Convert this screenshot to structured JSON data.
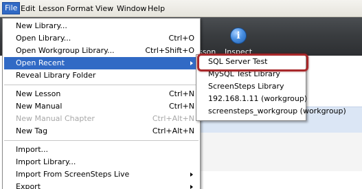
{
  "menubar": {
    "items": [
      "File",
      "Edit",
      "Lesson",
      "Format",
      "View",
      "Window",
      "Help"
    ]
  },
  "toolbar": {
    "partial_label": "sson",
    "inspect_label": "Inspect",
    "inspect_icon": "i"
  },
  "file_menu": {
    "items": [
      {
        "label": "New Library...",
        "shortcut": ""
      },
      {
        "label": "Open Library...",
        "shortcut": "Ctrl+O"
      },
      {
        "label": "Open Workgroup Library...",
        "shortcut": "Ctrl+Shift+O"
      },
      {
        "label": "Open Recent",
        "shortcut": ""
      },
      {
        "label": "Reveal Library Folder",
        "shortcut": ""
      },
      {
        "label": "New Lesson",
        "shortcut": "Ctrl+N"
      },
      {
        "label": "New Manual",
        "shortcut": "Ctrl+N"
      },
      {
        "label": "New Manual Chapter",
        "shortcut": "Ctrl+Alt+N"
      },
      {
        "label": "New Tag",
        "shortcut": "Ctrl+Alt+N"
      },
      {
        "label": "Import...",
        "shortcut": ""
      },
      {
        "label": "Import Library...",
        "shortcut": ""
      },
      {
        "label": "Import From ScreenSteps Live",
        "shortcut": ""
      },
      {
        "label": "Export",
        "shortcut": ""
      }
    ]
  },
  "recent_submenu": {
    "items": [
      "SQL Server Test",
      "MySQL Test Library",
      "ScreenSteps Library",
      "192.168.1.11 (workgroup)",
      "screensteps_workgroup (workgroup)"
    ]
  },
  "colors": {
    "highlight": "#316ac5",
    "callout": "#a8282a",
    "toolbar": "#3a3d40"
  }
}
